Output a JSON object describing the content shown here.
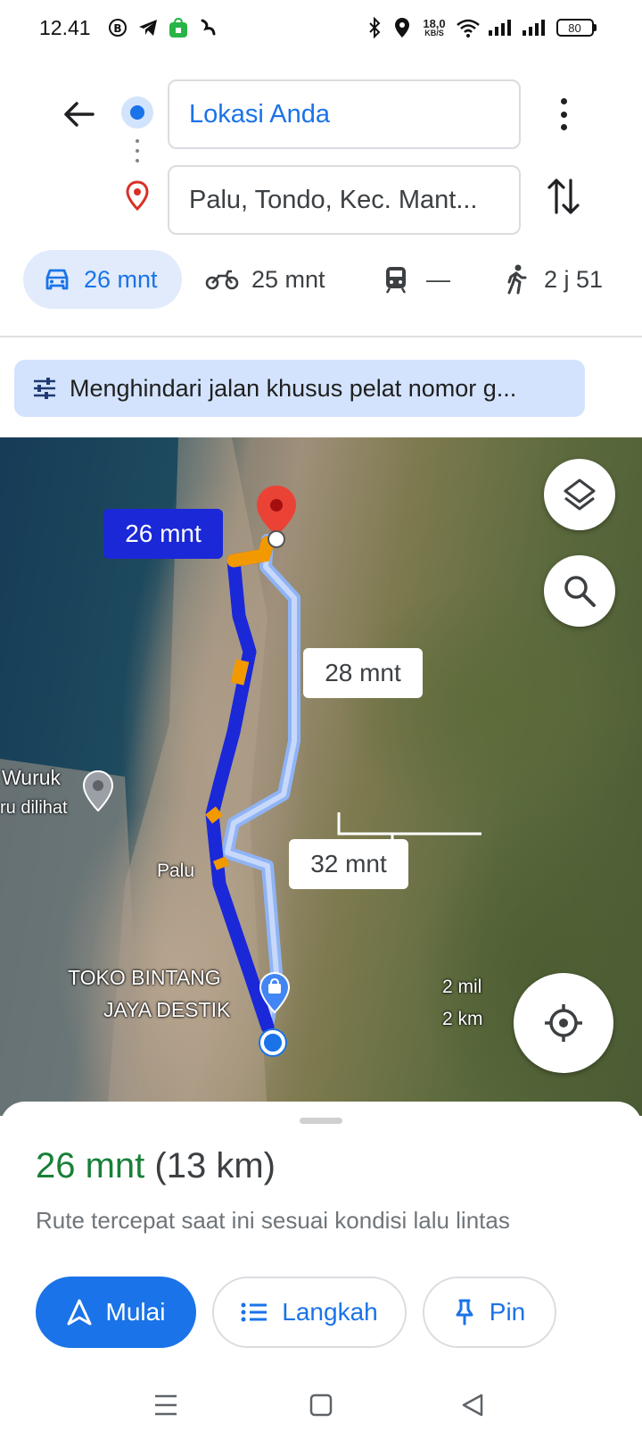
{
  "status_bar": {
    "time": "12.41",
    "net_speed_value": "18,0",
    "net_speed_unit": "KB/S",
    "battery": "80"
  },
  "directions": {
    "origin": "Lokasi Anda",
    "destination": "Palu, Tondo, Kec. Mant..."
  },
  "modes": [
    {
      "name": "car",
      "label": "26 mnt",
      "active": true
    },
    {
      "name": "motorcycle",
      "label": "25 mnt",
      "active": false
    },
    {
      "name": "transit",
      "label": "—",
      "active": false
    },
    {
      "name": "walk",
      "label": "2 j 51",
      "active": false
    }
  ],
  "options_chip": "Menghindari jalan khusus pelat nomor g...",
  "map": {
    "primary_route_label": "26 mnt",
    "alt_route_labels": [
      "28 mnt",
      "32 mnt"
    ],
    "place_labels": {
      "wuruk": "Wuruk",
      "recently_viewed": "ru dilihat",
      "palu": "Palu",
      "store_line1": "TOKO BINTANG",
      "store_line2": "JAYA DESTIK"
    },
    "scale": {
      "imperial": "2 mil",
      "metric": "2 km"
    }
  },
  "summary": {
    "eta": "26 mnt",
    "distance": "(13 km)",
    "note": "Rute tercepat saat ini sesuai kondisi lalu lintas"
  },
  "actions": {
    "start": "Mulai",
    "steps": "Langkah",
    "pin": "Pin"
  },
  "colors": {
    "accent": "#1a73e8",
    "route_primary": "#1a28d8",
    "traffic": "#f29900",
    "eta_green": "#188038",
    "destination_pin": "#d93025"
  }
}
